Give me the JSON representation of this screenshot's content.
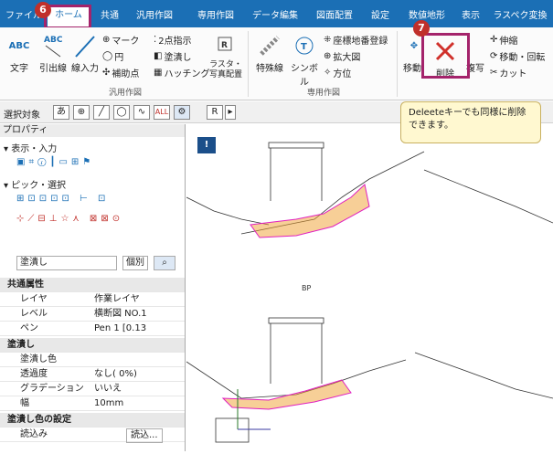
{
  "tabs": [
    "ファイル",
    "ホーム",
    "共通",
    "汎用作図",
    "専用作図",
    "データ編集",
    "図面配置",
    "設定",
    "数値地形",
    "表示",
    "ラスペク変換"
  ],
  "ribbon": {
    "text_btn": "文字",
    "leader_btn": "引出線",
    "line_btn": "線入力",
    "mark": "マーク",
    "circle": "円",
    "aux_point": "補助点",
    "two_point": "2点指示",
    "fill": "塗潰し",
    "hatching": "ハッチング",
    "raster": "ラスタ・写真配置",
    "special_line": "特殊線",
    "symbol": "シンボル",
    "coord_number": "座標地番登録",
    "enlarge": "拡大図",
    "north": "方位",
    "move": "移動",
    "delete": "削除",
    "copy": "複写",
    "stretch": "伸縮",
    "move_rotate": "移動・回転",
    "cut": "カット",
    "group_general": "汎用作図",
    "group_special": "専用作図"
  },
  "select_bar": {
    "label": "選択対象",
    "all": "ALL",
    "r": "R"
  },
  "properties": {
    "title": "プロパティ",
    "sec_display": "表示・入力",
    "sec_pick": "ピック・選択",
    "type_value": "塗潰し",
    "individual_btn": "個別",
    "common_attr": "共通属性",
    "rows": [
      {
        "k": "レイヤ",
        "v": "作業レイヤ"
      },
      {
        "k": "レベル",
        "v": "横断図 NO.1"
      },
      {
        "k": "ペン",
        "v": "Pen 1 [0.13"
      }
    ],
    "fill_cat": "塗潰し",
    "rows2": [
      {
        "k": "塗潰し色",
        "v": ""
      },
      {
        "k": "透過度",
        "v": "なし( 0%)"
      },
      {
        "k": "グラデーション",
        "v": "いいえ"
      },
      {
        "k": "幅",
        "v": "10mm"
      }
    ],
    "fill_color_setting": "塗潰し色の設定",
    "load": "読込み",
    "load_btn": "読込..."
  },
  "callout": {
    "text": "Deleeteキーでも同様に削除できます。"
  },
  "markers": {
    "m6": "6",
    "m7": "7"
  },
  "canvas": {
    "bp": "BP"
  }
}
